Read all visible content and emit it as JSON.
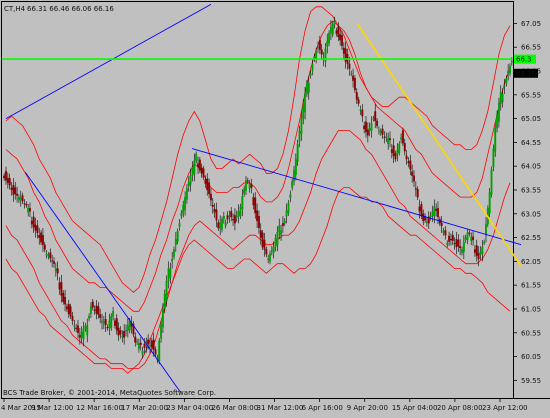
{
  "header": {
    "symbol_tf": "CT,H4",
    "ohlc": "66.31 66.46 66.06 66.16"
  },
  "footer": {
    "copyright": "BCS Trade Broker, © 2001-2014, MetaQuotes Software Corp."
  },
  "colors": {
    "background": "#c0c0c0",
    "bull_candle": "#00a000",
    "bear_candle": "#8b0000",
    "bands": "#ff0000",
    "trendline_blue": "#0000ff",
    "trendline_yellow": "#ffd700",
    "price_level": "#00ff00"
  },
  "chart_data": {
    "type": "candlestick",
    "y_axis": {
      "ticks": [
        "67.05",
        "66.55",
        "66.05",
        "65.55",
        "65.05",
        "64.55",
        "64.05",
        "63.55",
        "63.05",
        "62.55",
        "62.05",
        "61.55",
        "61.05",
        "60.55",
        "60.05",
        "59.55"
      ],
      "ylim": [
        59.2,
        67.5
      ]
    },
    "x_axis": {
      "ticks": [
        "4 Mar 2015",
        "9 Mar 12:00",
        "12 Mar 16:00",
        "17 Mar 20:00",
        "23 Mar 04:00",
        "26 Mar 08:00",
        "31 Mar 12:00",
        "6 Apr 16:00",
        "9 Apr 20:00",
        "15 Apr 04:00",
        "20 Apr 08:00",
        "23 Apr 12:00"
      ]
    },
    "current_price": "66.16",
    "horizontal_level": {
      "value": 66.3,
      "label": "66.3"
    },
    "indicators": [
      "Bollinger Bands (outer)",
      "Bollinger Bands (inner)"
    ],
    "trendlines": [
      {
        "color": "blue",
        "from": {
          "x": 0.0,
          "y": 65.05
        },
        "to": {
          "x": 37.0,
          "y": 67.45
        }
      },
      {
        "color": "blue",
        "from": {
          "x": 3.5,
          "y": 63.92
        },
        "to": {
          "x": 31.5,
          "y": 59.3
        }
      },
      {
        "color": "blue",
        "from": {
          "x": 33.6,
          "y": 64.42
        },
        "to": {
          "x": 93.0,
          "y": 62.4
        }
      },
      {
        "color": "yellow",
        "from": {
          "x": 63.4,
          "y": 67.05
        },
        "to": {
          "x": 93.0,
          "y": 61.95
        }
      }
    ],
    "candles_close": [
      63.8,
      63.5,
      63.4,
      63.2,
      63.0,
      62.8,
      62.5,
      62.2,
      62.0,
      61.7,
      61.3,
      61.0,
      60.7,
      60.4,
      60.6,
      61.2,
      61.0,
      60.8,
      60.6,
      60.9,
      60.6,
      60.5,
      60.8,
      60.3,
      60.2,
      60.4,
      60.3,
      60.0,
      61.0,
      61.8,
      62.4,
      62.9,
      63.4,
      63.8,
      64.2,
      64.0,
      63.6,
      63.2,
      62.7,
      62.9,
      63.1,
      62.9,
      63.2,
      63.7,
      63.5,
      63.0,
      62.4,
      62.1,
      62.3,
      62.7,
      63.0,
      63.5,
      64.2,
      65.0,
      65.7,
      66.3,
      66.6,
      66.3,
      66.8,
      67.0,
      66.8,
      66.3,
      66.0,
      65.4,
      65.0,
      64.8,
      65.1,
      64.8,
      64.6,
      64.5,
      64.3,
      64.7,
      64.2,
      63.8,
      63.3,
      63.0,
      62.9,
      63.2,
      62.8,
      62.5,
      62.6,
      62.4,
      62.3,
      62.6,
      62.4,
      62.2,
      62.5,
      63.5,
      64.8,
      65.5,
      66.0,
      66.3
    ],
    "upper_band_outer": [
      65.0,
      65.1,
      65.0,
      64.9,
      64.7,
      64.5,
      64.2,
      64.0,
      63.8,
      63.5,
      63.3,
      63.1,
      62.9,
      62.8,
      62.7,
      62.6,
      62.5,
      62.4,
      62.2,
      62.0,
      61.8,
      61.6,
      61.5,
      61.4,
      61.5,
      61.8,
      62.2,
      62.5,
      62.9,
      63.3,
      63.8,
      64.3,
      64.7,
      65.0,
      65.2,
      65.0,
      64.6,
      64.2,
      64.0,
      64.0,
      64.1,
      64.2,
      64.1,
      64.2,
      64.3,
      64.2,
      64.1,
      63.9,
      63.9,
      64.0,
      64.3,
      64.8,
      65.5,
      66.3,
      66.9,
      67.3,
      67.4,
      67.4,
      67.3,
      67.2,
      67.0,
      66.9,
      66.7,
      66.4,
      66.0,
      65.7,
      65.5,
      65.4,
      65.3,
      65.3,
      65.4,
      65.5,
      65.5,
      65.4,
      65.3,
      65.2,
      65.1,
      64.9,
      64.8,
      64.7,
      64.6,
      64.5,
      64.5,
      64.4,
      64.4,
      64.5,
      64.8,
      65.2,
      65.8,
      66.4,
      66.8,
      67.0
    ],
    "lower_band_outer": [
      62.1,
      61.9,
      61.8,
      61.6,
      61.4,
      61.2,
      61.0,
      60.9,
      60.7,
      60.6,
      60.5,
      60.4,
      60.3,
      60.2,
      60.1,
      60.0,
      59.9,
      59.9,
      59.9,
      59.8,
      59.8,
      59.8,
      59.7,
      59.8,
      59.9,
      60.1,
      60.4,
      60.7,
      61.0,
      61.3,
      61.6,
      61.9,
      62.2,
      62.4,
      62.5,
      62.4,
      62.3,
      62.2,
      62.1,
      62.0,
      61.9,
      61.9,
      62.0,
      62.1,
      62.1,
      62.0,
      61.9,
      61.8,
      61.9,
      62.0,
      62.0,
      61.9,
      61.8,
      61.9,
      61.9,
      62.0,
      62.2,
      62.5,
      62.8,
      63.2,
      63.5,
      63.6,
      63.6,
      63.5,
      63.4,
      63.4,
      63.3,
      63.3,
      63.2,
      63.0,
      62.9,
      62.8,
      62.7,
      62.6,
      62.6,
      62.5,
      62.4,
      62.3,
      62.2,
      62.1,
      62.0,
      61.9,
      61.9,
      61.8,
      61.8,
      61.7,
      61.6,
      61.4,
      61.3,
      61.2,
      61.1,
      61.0
    ],
    "upper_band_inner": [
      64.4,
      64.3,
      64.2,
      64.0,
      63.8,
      63.5,
      63.3,
      63.0,
      62.8,
      62.5,
      62.3,
      62.1,
      61.9,
      61.8,
      61.7,
      61.6,
      61.6,
      61.5,
      61.5,
      61.4,
      61.3,
      61.2,
      61.1,
      61.0,
      61.0,
      61.2,
      61.5,
      61.8,
      62.2,
      62.5,
      62.9,
      63.2,
      63.6,
      63.9,
      64.1,
      64.0,
      63.8,
      63.6,
      63.5,
      63.5,
      63.5,
      63.6,
      63.6,
      63.7,
      63.7,
      63.6,
      63.4,
      63.3,
      63.3,
      63.4,
      63.6,
      64.0,
      64.5,
      65.0,
      65.6,
      66.1,
      66.5,
      66.8,
      67.0,
      67.1,
      67.0,
      66.8,
      66.5,
      66.2,
      65.9,
      65.7,
      65.5,
      65.3,
      65.2,
      65.1,
      65.0,
      64.9,
      64.8,
      64.6,
      64.4,
      64.3,
      64.1,
      63.9,
      63.8,
      63.7,
      63.6,
      63.5,
      63.4,
      63.4,
      63.4,
      63.5,
      63.8,
      64.3,
      64.8,
      65.3,
      65.8,
      66.1
    ],
    "lower_band_inner": [
      62.8,
      62.6,
      62.5,
      62.3,
      62.1,
      61.9,
      61.6,
      61.4,
      61.2,
      61.0,
      60.8,
      60.7,
      60.5,
      60.4,
      60.3,
      60.2,
      60.1,
      60.0,
      60.0,
      59.9,
      59.9,
      59.9,
      59.8,
      59.8,
      59.8,
      59.9,
      60.1,
      60.4,
      60.8,
      61.2,
      61.6,
      62.0,
      62.3,
      62.6,
      62.8,
      62.9,
      62.8,
      62.7,
      62.6,
      62.5,
      62.4,
      62.3,
      62.4,
      62.5,
      62.6,
      62.6,
      62.5,
      62.4,
      62.4,
      62.5,
      62.6,
      62.6,
      62.7,
      62.9,
      63.2,
      63.5,
      63.9,
      64.2,
      64.4,
      64.6,
      64.8,
      64.8,
      64.8,
      64.7,
      64.6,
      64.4,
      64.3,
      64.1,
      63.9,
      63.7,
      63.5,
      63.3,
      63.2,
      63.0,
      62.9,
      62.8,
      62.7,
      62.6,
      62.5,
      62.4,
      62.3,
      62.2,
      62.1,
      62.0,
      62.0,
      62.0,
      62.1,
      62.3,
      62.6,
      63.0,
      63.4,
      63.7
    ]
  }
}
